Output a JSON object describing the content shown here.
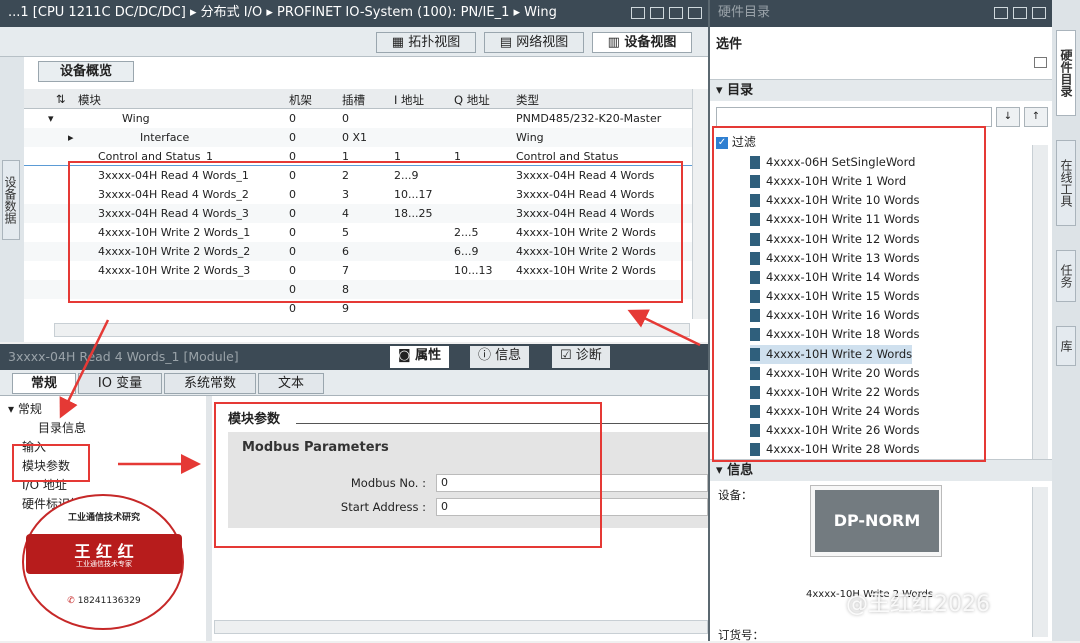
{
  "top_title": "...1 [CPU 1211C DC/DC/DC] ▸ 分布式 I/O ▸ PROFINET IO-System (100): PN/IE_1 ▸ Wing",
  "view_tabs": {
    "topology": "拓扑视图",
    "network": "网络视图",
    "device": "设备视图"
  },
  "overview_tab": "设备概览",
  "columns": {
    "module": "模块",
    "rack": "机架",
    "slot": "插槽",
    "iaddr": "I 地址",
    "qaddr": "Q 地址",
    "type": "类型"
  },
  "rows": [
    {
      "module": "Wing",
      "rack": "0",
      "slot": "0",
      "iaddr": "",
      "qaddr": "",
      "type": "PNMD485/232-K20-Master"
    },
    {
      "module": "Interface",
      "rack": "0",
      "slot": "0 X1",
      "iaddr": "",
      "qaddr": "",
      "type": "Wing"
    },
    {
      "module": "Control and Status_1",
      "rack": "0",
      "slot": "1",
      "iaddr": "1",
      "qaddr": "1",
      "type": "Control and Status"
    },
    {
      "module": "3xxxx-04H Read 4 Words_1",
      "rack": "0",
      "slot": "2",
      "iaddr": "2...9",
      "qaddr": "",
      "type": "3xxxx-04H Read 4 Words"
    },
    {
      "module": "3xxxx-04H Read 4 Words_2",
      "rack": "0",
      "slot": "3",
      "iaddr": "10...17",
      "qaddr": "",
      "type": "3xxxx-04H Read 4 Words"
    },
    {
      "module": "3xxxx-04H Read 4 Words_3",
      "rack": "0",
      "slot": "4",
      "iaddr": "18...25",
      "qaddr": "",
      "type": "3xxxx-04H Read 4 Words"
    },
    {
      "module": "4xxxx-10H Write 2 Words_1",
      "rack": "0",
      "slot": "5",
      "iaddr": "",
      "qaddr": "2...5",
      "type": "4xxxx-10H Write 2 Words"
    },
    {
      "module": "4xxxx-10H Write 2 Words_2",
      "rack": "0",
      "slot": "6",
      "iaddr": "",
      "qaddr": "6...9",
      "type": "4xxxx-10H Write 2 Words"
    },
    {
      "module": "4xxxx-10H Write 2 Words_3",
      "rack": "0",
      "slot": "7",
      "iaddr": "",
      "qaddr": "10...13",
      "type": "4xxxx-10H Write 2 Words"
    },
    {
      "module": "",
      "rack": "0",
      "slot": "8",
      "iaddr": "",
      "qaddr": "",
      "type": ""
    },
    {
      "module": "",
      "rack": "0",
      "slot": "9",
      "iaddr": "",
      "qaddr": "",
      "type": ""
    }
  ],
  "left_vtab": "设备数据",
  "props_title": "3xxxx-04H Read 4 Words_1 [Module]",
  "props_tabs": {
    "properties": "属性",
    "info": "信息",
    "diag": "诊断"
  },
  "sub_tabs": [
    "常规",
    "IO 变量",
    "系统常数",
    "文本"
  ],
  "nav": {
    "general": "常规",
    "catalog": "目录信息",
    "input": "输入",
    "module_params": "模块参数",
    "io_addr": "I/O 地址",
    "hw_id": "硬件标识符"
  },
  "section_title": "模块参数",
  "group_title": "Modbus Parameters",
  "fields": [
    {
      "label": "Modbus No. :",
      "value": "0"
    },
    {
      "label": "Start Address :",
      "value": "0"
    }
  ],
  "stamp": {
    "top": "工业通信技术研究",
    "name": "王 红 红",
    "sub": "工业通信技术专家",
    "phone": "18241136329"
  },
  "catalog_title": "硬件目录",
  "options": "选件",
  "catalog_section": "目录",
  "filter": "过滤",
  "catalog_items": [
    "4xxxx-06H SetSingleWord",
    "4xxxx-10H Write 1 Word",
    "4xxxx-10H Write 10 Words",
    "4xxxx-10H Write 11 Words",
    "4xxxx-10H Write 12 Words",
    "4xxxx-10H Write 13 Words",
    "4xxxx-10H Write 14 Words",
    "4xxxx-10H Write 15 Words",
    "4xxxx-10H Write 16 Words",
    "4xxxx-10H Write 18 Words",
    "4xxxx-10H Write 2 Words",
    "4xxxx-10H Write 20 Words",
    "4xxxx-10H Write 22 Words",
    "4xxxx-10H Write 24 Words",
    "4xxxx-10H Write 26 Words",
    "4xxxx-10H Write 28 Words"
  ],
  "info_section": "信息",
  "device_label": "设备：",
  "device_image": "DP-NORM",
  "device_name": "4xxxx-10H Write 2 Words",
  "order_label": "订货号：",
  "watermark": "@王红红2026",
  "right_vtabs": [
    "硬件目录",
    "在线工具",
    "任务",
    "库"
  ]
}
